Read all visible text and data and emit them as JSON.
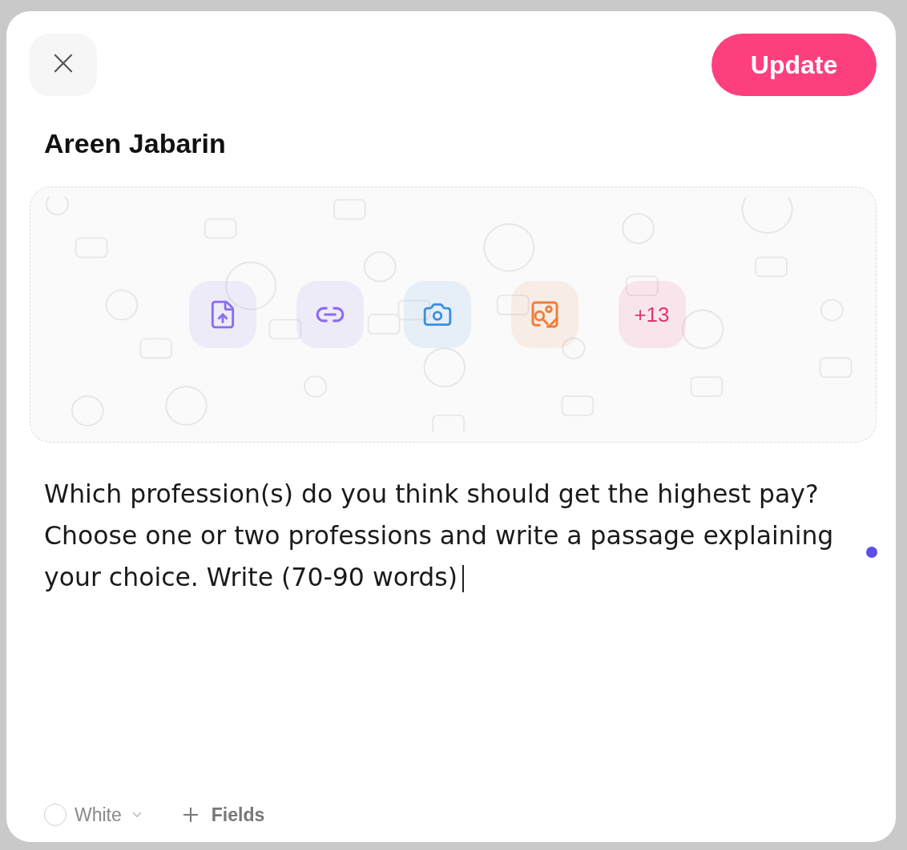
{
  "dialog": {
    "close_button": {
      "label": "×"
    },
    "update_button": {
      "label": "Update"
    },
    "title": "Areen Jabarin"
  },
  "attachments": [
    {
      "kind": "file-upload",
      "color": "#8b6cf0"
    },
    {
      "kind": "link",
      "color": "#8b6cf0"
    },
    {
      "kind": "camera",
      "color": "#3a8ee0"
    },
    {
      "kind": "image-search",
      "color": "#ef7f3a"
    },
    {
      "kind": "more",
      "color": "#e0356f",
      "label": "+13"
    }
  ],
  "body": {
    "text": "Which profession(s) do you think should get the highest pay? Choose one or two professions and write a passage explaining your choice. Write (70-90 words)",
    "focused": true
  },
  "footer": {
    "color_select": {
      "value": "White"
    },
    "fields_button": {
      "label": "Fields"
    }
  }
}
